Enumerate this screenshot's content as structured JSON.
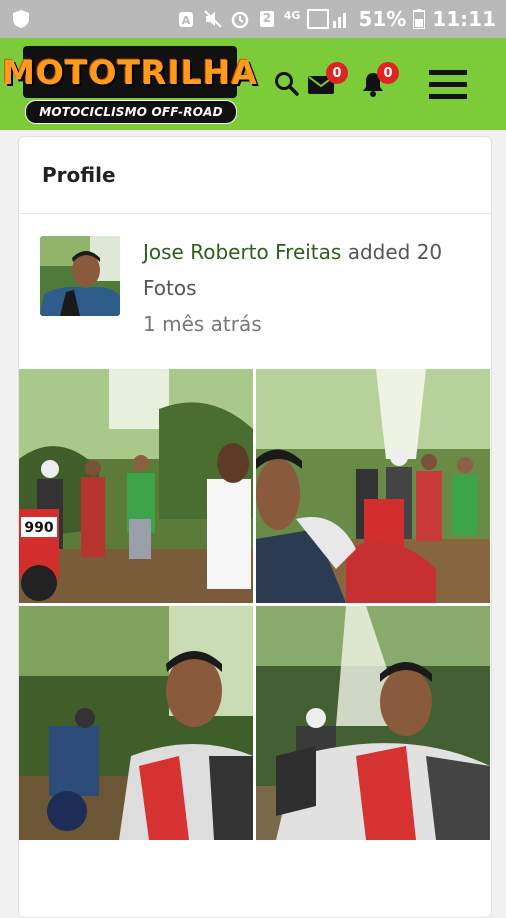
{
  "status_bar": {
    "battery_percent": "51%",
    "time": "11:11",
    "sim_badge": "2",
    "network": "4G",
    "icons": [
      "shield-icon",
      "alarm-clock-icon",
      "mute-icon",
      "alarm-icon",
      "sim-icon",
      "signal-icon",
      "battery-icon"
    ]
  },
  "header": {
    "logo_title": "MOTOTRILHA",
    "logo_subtitle": "MOTOCICLISMO OFF-ROAD",
    "messages_count": "0",
    "notifications_count": "0",
    "icons": [
      "search-icon",
      "mail-icon",
      "bell-icon",
      "menu-icon"
    ],
    "colors": {
      "bar": "#7ccc3a",
      "logo_orange": "#ff9a1f",
      "badge": "#e02424"
    }
  },
  "profile_card": {
    "title": "Profile",
    "post": {
      "author": "Jose Roberto Freitas",
      "action": "added 20 Fotos",
      "time_ago": "1 mês atrás",
      "photos": [
        "photo-group-riders-1",
        "photo-selfie-riders-2",
        "photo-selfie-forest-3",
        "photo-selfie-sunlight-4"
      ]
    }
  }
}
